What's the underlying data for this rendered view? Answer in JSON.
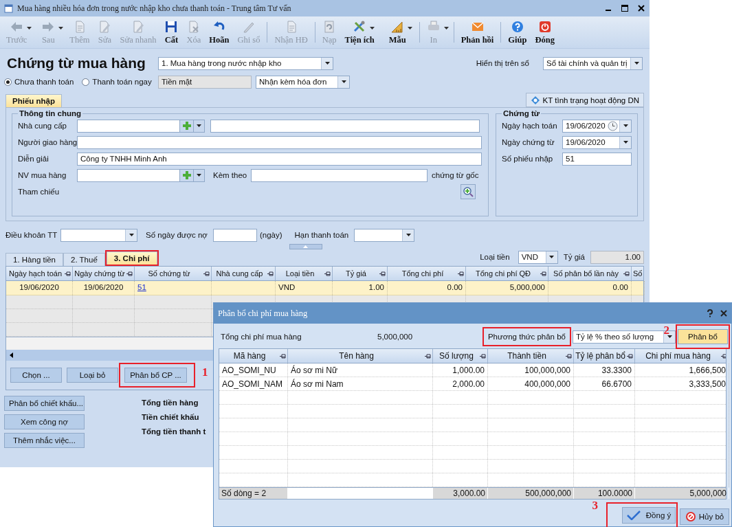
{
  "window": {
    "title": "Mua hàng nhiều hóa đơn trong nước nhập kho chưa thanh toán - Trung tâm Tư vấn"
  },
  "toolbar": [
    {
      "label": "Trước",
      "kind": "back",
      "enabled": false,
      "dropdown": true,
      "separator_before": false
    },
    {
      "label": "Sau",
      "kind": "forward",
      "enabled": false,
      "dropdown": true,
      "separator_before": false
    },
    {
      "label": "Thêm",
      "kind": "document",
      "enabled": false,
      "dropdown": false,
      "separator_before": false
    },
    {
      "label": "Sửa",
      "kind": "edit",
      "enabled": false,
      "dropdown": false,
      "separator_before": false
    },
    {
      "label": "Sửa nhanh",
      "kind": "edit",
      "enabled": false,
      "dropdown": false,
      "separator_before": false
    },
    {
      "label": "Cất",
      "kind": "save",
      "enabled": true,
      "dropdown": false,
      "separator_before": false
    },
    {
      "label": "Xóa",
      "kind": "delete",
      "enabled": false,
      "dropdown": false,
      "separator_before": false
    },
    {
      "label": "Hoãn",
      "kind": "undo",
      "enabled": true,
      "dropdown": false,
      "separator_before": false
    },
    {
      "label": "Ghi sổ",
      "kind": "pencil",
      "enabled": false,
      "dropdown": false,
      "separator_before": false
    },
    {
      "label": "Nhận HĐ",
      "kind": "document",
      "enabled": false,
      "dropdown": false,
      "separator_before": true
    },
    {
      "label": "Nạp",
      "kind": "refresh",
      "enabled": false,
      "dropdown": false,
      "separator_before": true
    },
    {
      "label": "Tiện ích",
      "kind": "tools",
      "enabled": true,
      "dropdown": true,
      "separator_before": false
    },
    {
      "label": "Mẫu",
      "kind": "ruler",
      "enabled": true,
      "dropdown": true,
      "separator_before": false
    },
    {
      "label": "In",
      "kind": "printer",
      "enabled": false,
      "dropdown": true,
      "separator_before": true
    },
    {
      "label": "Phản hồi",
      "kind": "mail",
      "enabled": true,
      "dropdown": false,
      "separator_before": true
    },
    {
      "label": "Giúp",
      "kind": "help",
      "enabled": true,
      "dropdown": false,
      "separator_before": true
    },
    {
      "label": "Đóng",
      "kind": "power",
      "enabled": true,
      "dropdown": false,
      "separator_before": false
    }
  ],
  "header": {
    "title": "Chứng từ mua hàng",
    "voucher_type": "1. Mua hàng trong nước nhập kho",
    "payment_options": [
      {
        "label": "Chưa thanh toán",
        "selected": true
      },
      {
        "label": "Thanh toán ngay",
        "selected": false
      }
    ],
    "payment_method": "Tiền mặt",
    "invoice_option": "Nhận kèm hóa đơn",
    "ledger_label": "Hiển thị trên sổ",
    "ledger": "Sổ tài chính và quản trị"
  },
  "form_tabs": [
    {
      "label": "Phiếu nhập",
      "selected": true
    }
  ],
  "check_button": "KT tình trạng hoạt động DN",
  "general": {
    "title": "Thông tin chung",
    "supplier_label": "Nhà cung cấp",
    "deliverer_label": "Người giao hàng",
    "description_label": "Diễn giải",
    "description": "Công ty TNHH Minh Anh",
    "buyer_label": "NV mua hàng",
    "attached_label": "Kèm theo",
    "attached_suffix": "chứng từ gốc",
    "reference_label": "Tham chiếu"
  },
  "voucher": {
    "title": "Chứng từ",
    "posting_date_label": "Ngày hạch toán",
    "posting_date": "19/06/2020",
    "voucher_date_label": "Ngày chứng từ",
    "voucher_date": "19/06/2020",
    "number_label": "Số phiếu nhập",
    "number": "51"
  },
  "terms": {
    "terms_label": "Điều khoản TT",
    "days_label": "Số ngày được nợ",
    "days_unit": "(ngày)",
    "due_label": "Hạn thanh toán"
  },
  "currency": {
    "label": "Loại tiền",
    "value": "VND",
    "rate_label": "Tỷ giá",
    "rate": "1.00"
  },
  "detail_tabs": [
    {
      "label": "1. Hàng tiền",
      "selected": false,
      "highlighted": false
    },
    {
      "label": "2. Thuế",
      "selected": false,
      "highlighted": false
    },
    {
      "label": "3. Chi phí",
      "selected": true,
      "highlighted": true
    }
  ],
  "cost_table": {
    "columns": [
      {
        "label": "Ngày hạch toán",
        "kind": "center"
      },
      {
        "label": "Ngày chứng từ",
        "kind": "center"
      },
      {
        "label": "Số chứng từ",
        "kind": "link"
      },
      {
        "label": "Nhà cung cấp",
        "kind": "text"
      },
      {
        "label": "Loại tiền",
        "kind": "text"
      },
      {
        "label": "Tỷ giá",
        "kind": "number"
      },
      {
        "label": "Tổng chi phí",
        "kind": "number"
      },
      {
        "label": "Tổng chi phí QĐ",
        "kind": "number"
      },
      {
        "label": "Số phân bổ lần này",
        "kind": "number"
      },
      {
        "label": "Số",
        "kind": "text"
      }
    ],
    "rows": [
      {
        "cells": [
          "19/06/2020",
          "19/06/2020",
          "51",
          null,
          "VND",
          "1.00",
          "0.00",
          "5,000,000",
          "0.00",
          null
        ]
      }
    ]
  },
  "cost_buttons": [
    {
      "label": "Chọn ...",
      "highlighted": false
    },
    {
      "label": "Loại bỏ",
      "highlighted": false
    },
    {
      "label": "Phân bổ CP ...",
      "highlighted": true,
      "callout": "1"
    }
  ],
  "side_buttons": [
    "Phân bổ chiết khấu...",
    "Xem công nợ",
    "Thêm nhắc việc..."
  ],
  "totals": [
    "Tổng tiền hàng",
    "Tiền chiết khấu",
    "Tổng tiền thanh t"
  ],
  "dialog": {
    "title": "Phân bổ chi phí mua hàng",
    "total_label": "Tổng chi phí mua hàng",
    "total": "5,000,000",
    "method_label": "Phương thức phân bổ",
    "method_highlighted": true,
    "method": "Tỷ lệ % theo số lượng",
    "allocate_button": {
      "label": "Phân bổ",
      "highlighted": true,
      "callout": "2"
    },
    "columns": [
      {
        "label": "Mã hàng",
        "kind": "text"
      },
      {
        "label": "Tên hàng",
        "kind": "text"
      },
      {
        "label": "Số lượng",
        "kind": "number"
      },
      {
        "label": "Thành tiền",
        "kind": "number"
      },
      {
        "label": "Tỷ lệ phân bổ",
        "kind": "number"
      },
      {
        "label": "Chi phí mua hàng",
        "kind": "number"
      }
    ],
    "rows": [
      {
        "cells": [
          "AO_SOMI_NU",
          "Áo sơ mi Nữ",
          "1,000.00",
          "100,000,000",
          "33.3300",
          "1,666,500"
        ]
      },
      {
        "cells": [
          "AO_SOMI_NAM",
          "Áo sơ mi Nam",
          "2,000.00",
          "400,000,000",
          "66.6700",
          "3,333,500"
        ]
      }
    ],
    "footer": {
      "count": "Số dòng = 2",
      "totals": [
        "3,000.00",
        "500,000,000",
        "100.0000",
        "5,000,000"
      ]
    },
    "ok_button": {
      "label": "Đồng ý",
      "highlighted": true,
      "callout": "3"
    },
    "cancel_button": "Hủy bỏ"
  }
}
